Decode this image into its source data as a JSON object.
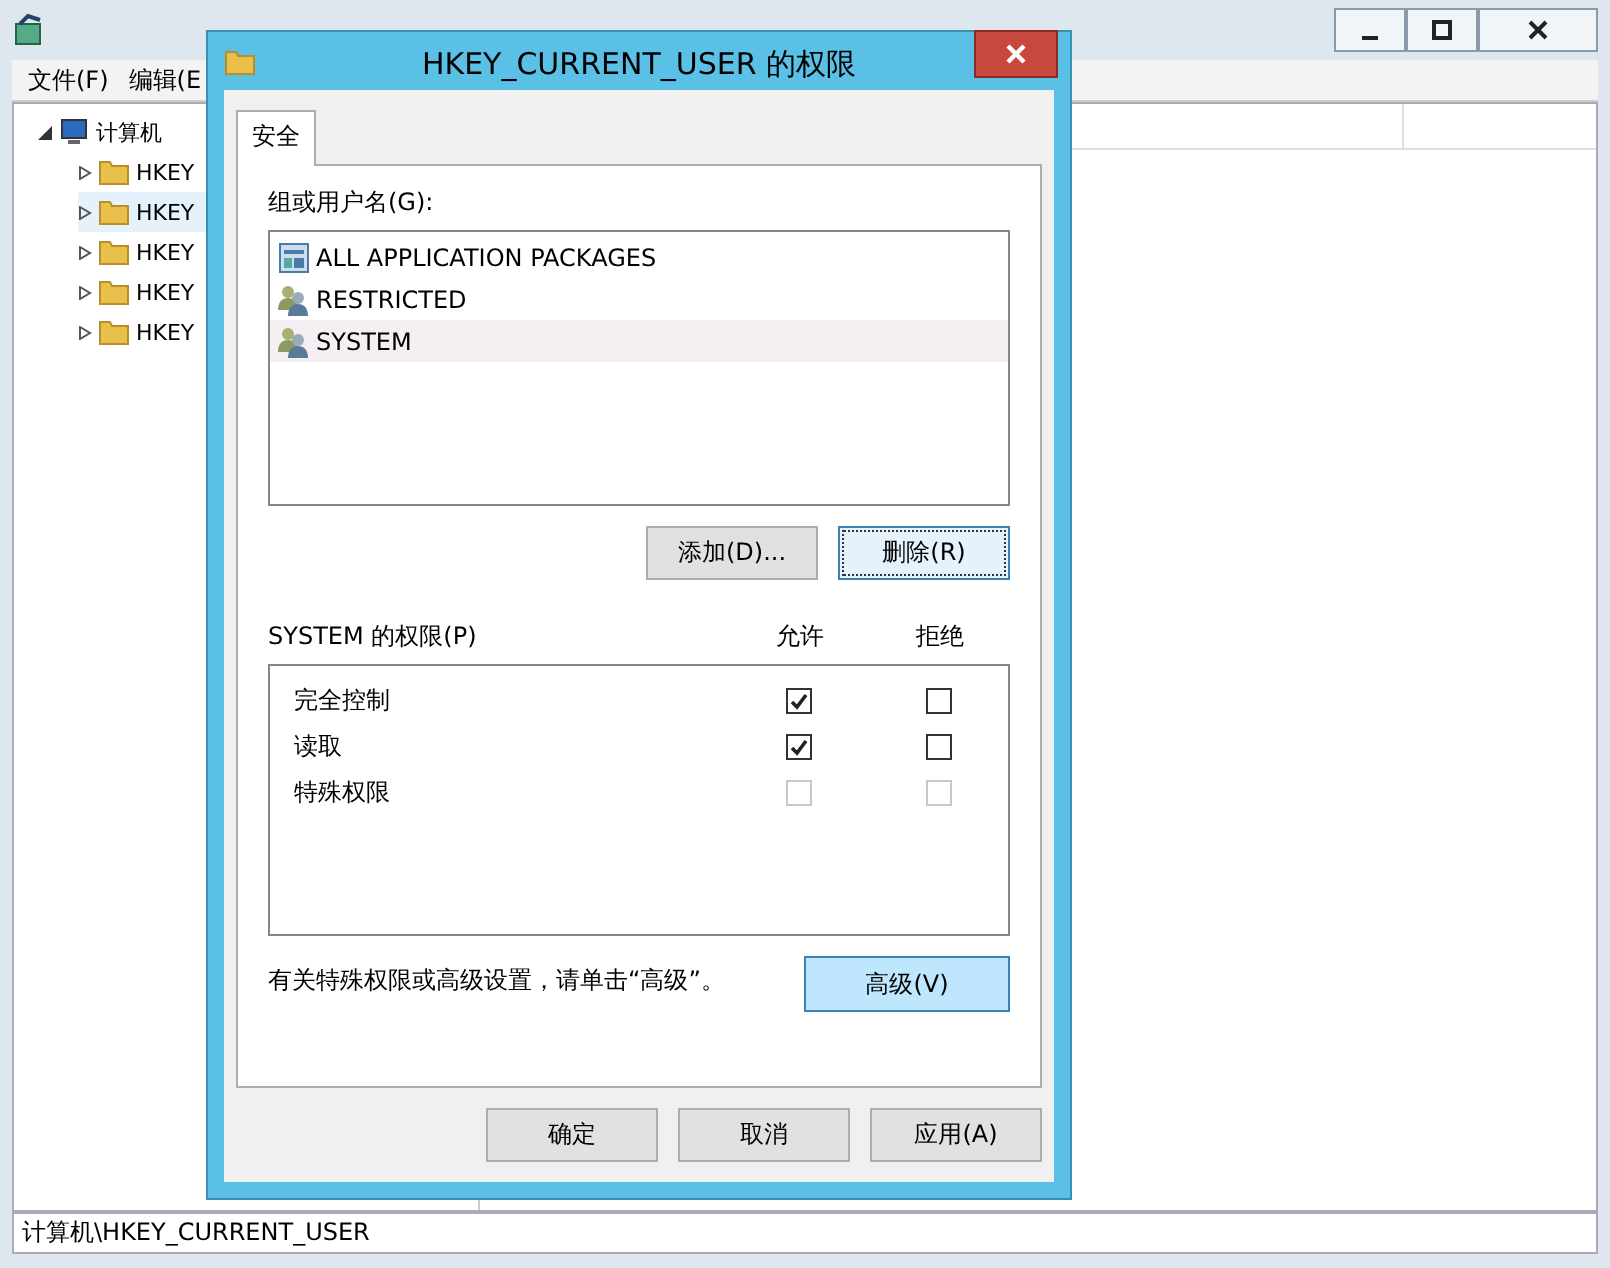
{
  "main_window": {
    "menu": [
      "文件(F)",
      "编辑(E"
    ],
    "tree": {
      "label": "计算机",
      "expanded": true,
      "children": [
        {
          "label": "HKEY",
          "selected": false
        },
        {
          "label": "HKEY",
          "selected": true
        },
        {
          "label": "HKEY",
          "selected": false
        },
        {
          "label": "HKEY",
          "selected": false
        },
        {
          "label": "HKEY",
          "selected": false
        }
      ]
    },
    "status_bar": "计算机\\HKEY_CURRENT_USER"
  },
  "dialog": {
    "title": "HKEY_CURRENT_USER 的权限",
    "tabs": [
      {
        "label": "安全",
        "selected": true
      }
    ],
    "group_label": "组或用户名(G):",
    "principals": [
      {
        "name": "ALL APPLICATION PACKAGES",
        "kind": "package",
        "selected": false
      },
      {
        "name": "RESTRICTED",
        "kind": "group",
        "selected": false
      },
      {
        "name": "SYSTEM",
        "kind": "group",
        "selected": true
      }
    ],
    "principal_buttons": [
      "添加(D)...",
      "删除(R)"
    ],
    "permissions_label": "SYSTEM 的权限(P)",
    "columns": [
      "允许",
      "拒绝"
    ],
    "permissions": [
      {
        "name": "完全控制",
        "allow": {
          "checked": true,
          "disabled": false
        },
        "deny": {
          "checked": false,
          "disabled": false
        }
      },
      {
        "name": "读取",
        "allow": {
          "checked": true,
          "disabled": false
        },
        "deny": {
          "checked": false,
          "disabled": false
        }
      },
      {
        "name": "特殊权限",
        "allow": {
          "checked": false,
          "disabled": true
        },
        "deny": {
          "checked": false,
          "disabled": true
        }
      }
    ],
    "advanced_note": "有关特殊权限或高级设置，请单击“高级”。",
    "advanced_button": "高级(V)",
    "buttons": [
      "确定",
      "取消",
      "应用(A)"
    ]
  }
}
